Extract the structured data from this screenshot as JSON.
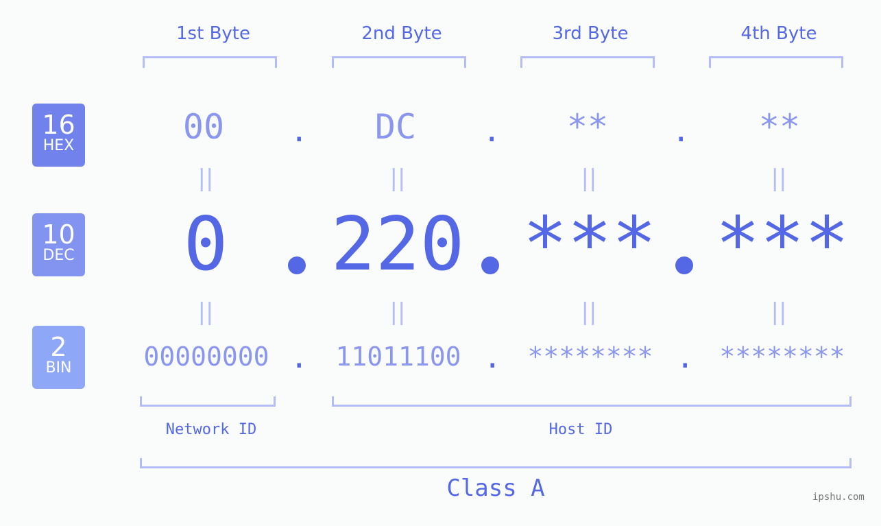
{
  "bytes": [
    {
      "label": "1st Byte",
      "hex": "00",
      "dec": "0",
      "bin": "00000000"
    },
    {
      "label": "2nd Byte",
      "hex": "DC",
      "dec": "220",
      "bin": "11011100"
    },
    {
      "label": "3rd Byte",
      "hex": "**",
      "dec": "***",
      "bin": "********"
    },
    {
      "label": "4th Byte",
      "hex": "**",
      "dec": "***",
      "bin": "********"
    }
  ],
  "badges": {
    "hex": {
      "base": "16",
      "label": "HEX",
      "color": "#7182ec"
    },
    "dec": {
      "base": "10",
      "label": "DEC",
      "color": "#8393f0"
    },
    "bin": {
      "base": "2",
      "label": "BIN",
      "color": "#8fa7f7"
    }
  },
  "separators": {
    "dot": ".",
    "equals": "="
  },
  "network_id_label": "Network ID",
  "host_id_label": "Host ID",
  "class_label": "Class A",
  "watermark": "ipshu.com",
  "colors": {
    "accent": "#5468e6",
    "light": "#8b97ee",
    "bracket": "#b4bdf6",
    "background": "#fafcfb"
  }
}
